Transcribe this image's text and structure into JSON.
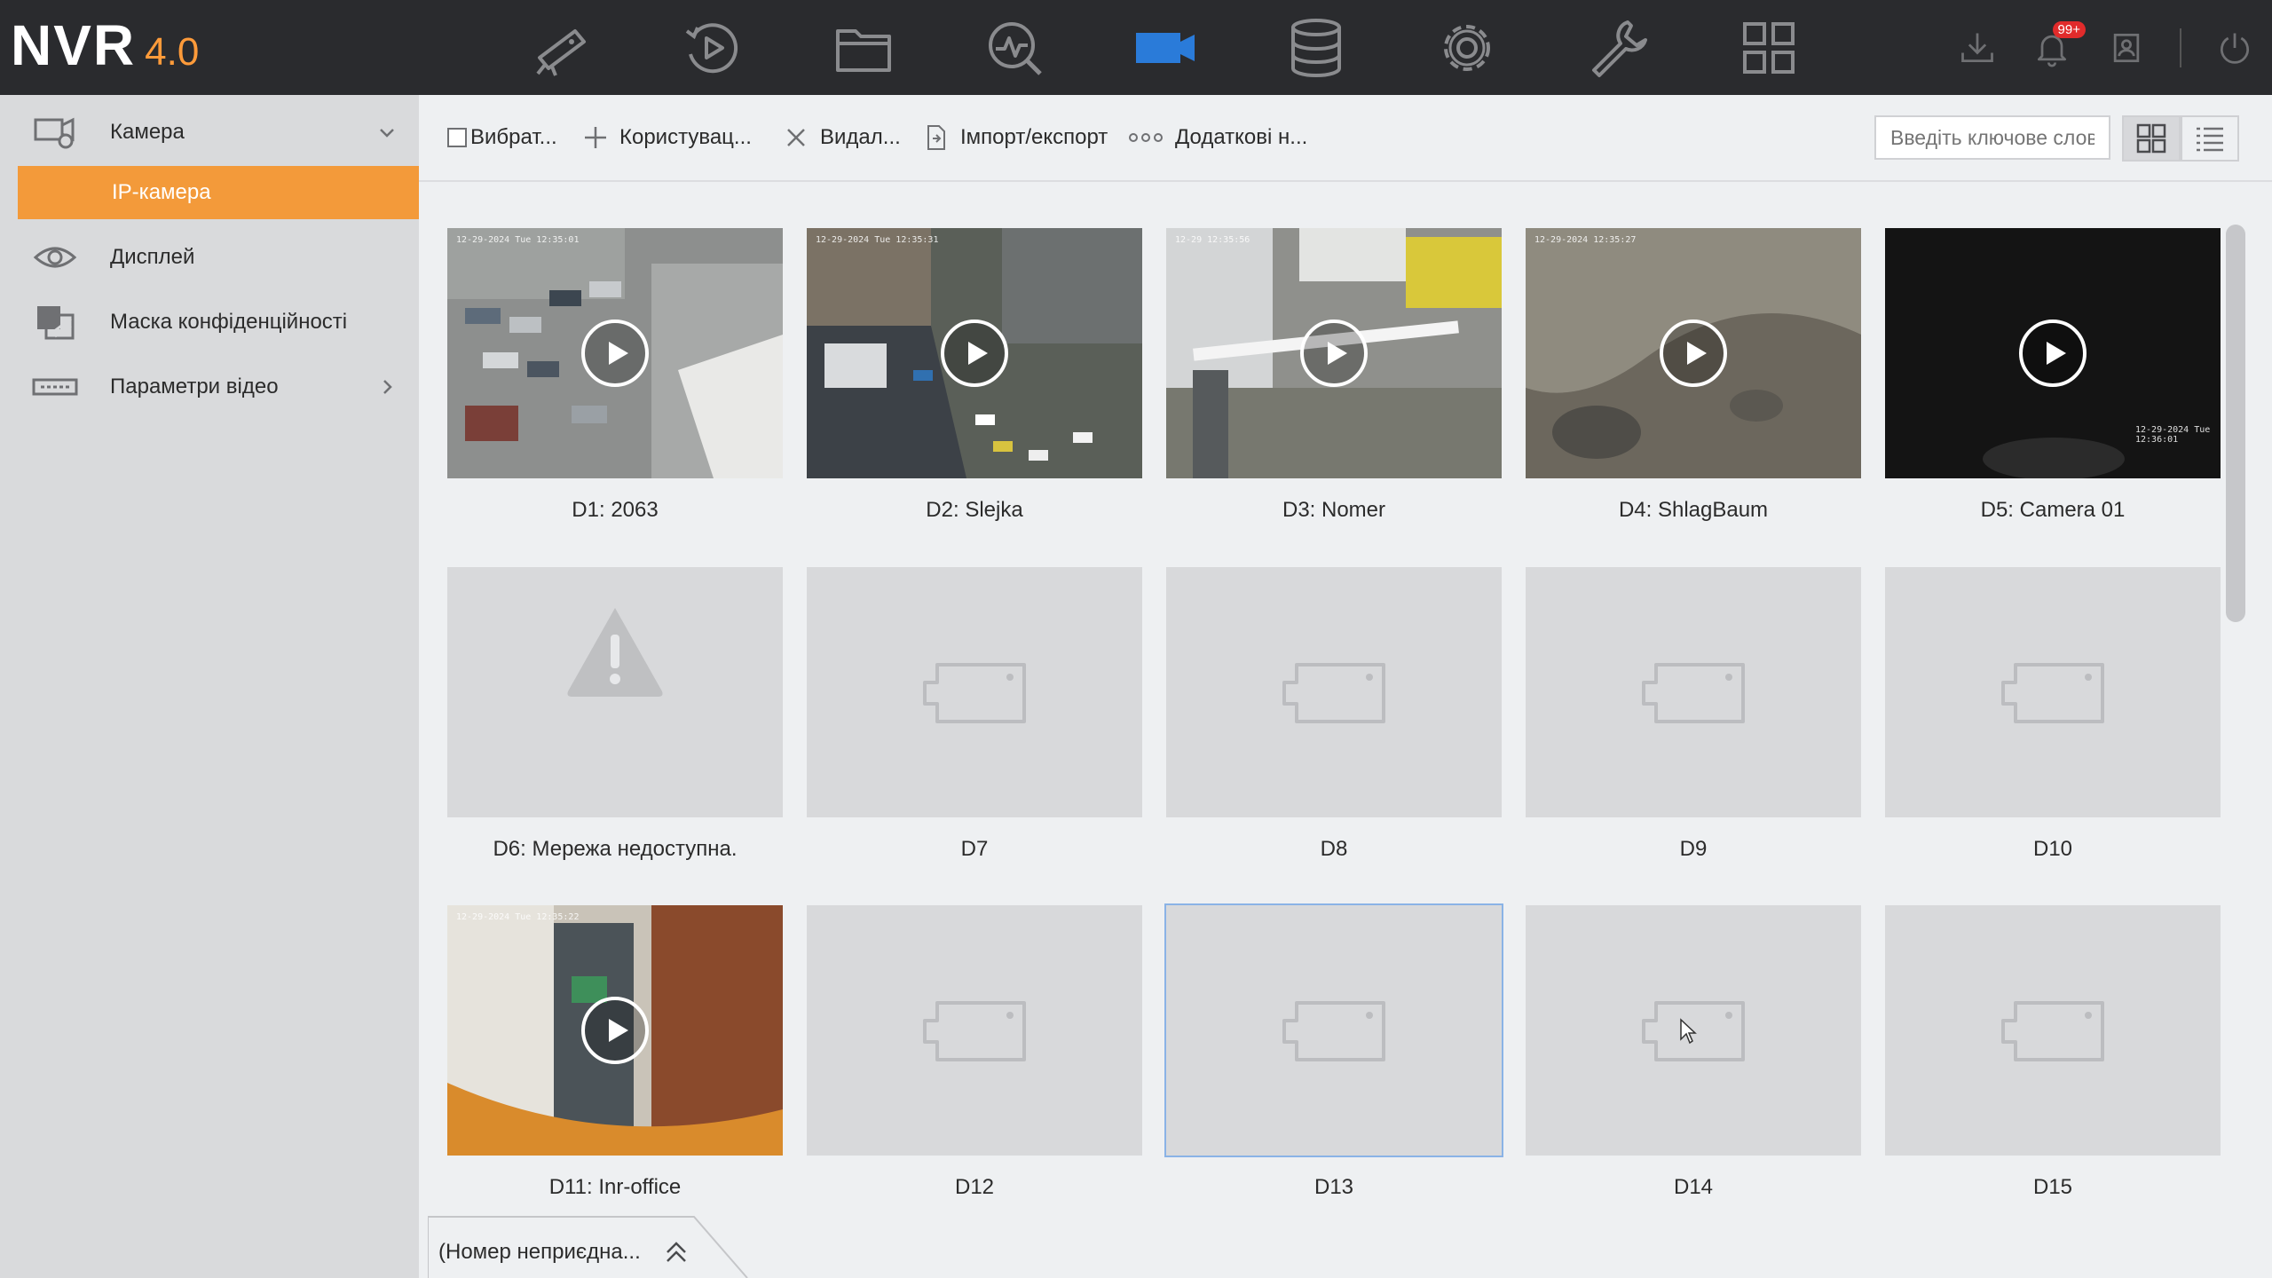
{
  "app": {
    "logo": "NVR",
    "version": "4.0"
  },
  "top_nav": [
    {
      "name": "live-view-icon"
    },
    {
      "name": "playback-icon"
    },
    {
      "name": "file-icon"
    },
    {
      "name": "analytics-icon"
    },
    {
      "name": "camera-icon",
      "active": true
    },
    {
      "name": "storage-icon"
    },
    {
      "name": "settings-icon"
    },
    {
      "name": "maintenance-icon"
    },
    {
      "name": "grid-icon"
    }
  ],
  "top_right": {
    "notification_badge": "99+"
  },
  "sidebar": {
    "items": [
      {
        "label": "Камера",
        "icon": "camera-group-icon",
        "expanded": true
      },
      {
        "label": "IP-камера",
        "active": true
      },
      {
        "label": "Дисплей",
        "icon": "eye-icon"
      },
      {
        "label": "Маска конфіденційності",
        "icon": "privacy-mask-icon"
      },
      {
        "label": "Параметри відео",
        "icon": "video-params-icon"
      }
    ]
  },
  "toolbar": {
    "select": "Вибрат...",
    "add_user": "Користувац...",
    "delete": "Видал...",
    "import_export": "Імпорт/експорт",
    "more": "Додаткові н...",
    "search_placeholder": "Введіть ключове слово"
  },
  "cameras": [
    {
      "label": "D1: 2063",
      "state": "live"
    },
    {
      "label": "D2: Slejka",
      "state": "live"
    },
    {
      "label": "D3: Nomer",
      "state": "live"
    },
    {
      "label": "D4: ShlagBaum",
      "state": "live"
    },
    {
      "label": "D5: Camera 01",
      "state": "live-dark"
    },
    {
      "label": "D6: Мережа недоступна.",
      "state": "warning"
    },
    {
      "label": "D7",
      "state": "empty"
    },
    {
      "label": "D8",
      "state": "empty"
    },
    {
      "label": "D9",
      "state": "empty"
    },
    {
      "label": "D10",
      "state": "empty"
    },
    {
      "label": "D11: Inr-office",
      "state": "live"
    },
    {
      "label": "D12",
      "state": "empty"
    },
    {
      "label": "D13",
      "state": "empty",
      "selected": true
    },
    {
      "label": "D14",
      "state": "empty"
    },
    {
      "label": "D15",
      "state": "empty"
    }
  ],
  "bottom_tab": {
    "label": "(Номер неприєдна..."
  },
  "colors": {
    "accent": "#f39a3a",
    "active_nav": "#2a7bd9",
    "topbar": "#2a2b2e"
  }
}
